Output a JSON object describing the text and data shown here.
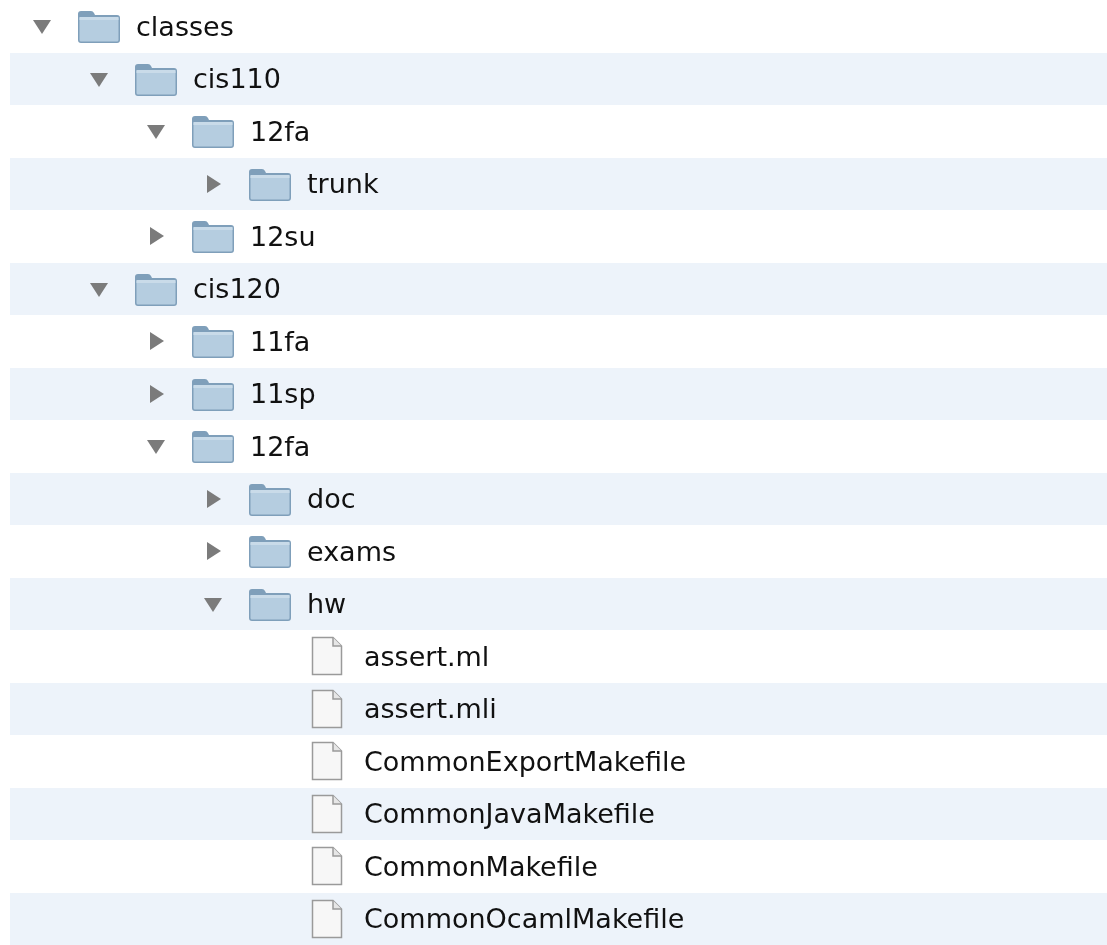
{
  "tree": [
    {
      "kind": "folder",
      "name": "classes",
      "expanded": true,
      "children": [
        {
          "kind": "folder",
          "name": "cis110",
          "expanded": true,
          "children": [
            {
              "kind": "folder",
              "name": "12fa",
              "expanded": true,
              "children": [
                {
                  "kind": "folder",
                  "name": "trunk",
                  "expanded": false
                }
              ]
            },
            {
              "kind": "folder",
              "name": "12su",
              "expanded": false
            }
          ]
        },
        {
          "kind": "folder",
          "name": "cis120",
          "expanded": true,
          "children": [
            {
              "kind": "folder",
              "name": "11fa",
              "expanded": false
            },
            {
              "kind": "folder",
              "name": "11sp",
              "expanded": false
            },
            {
              "kind": "folder",
              "name": "12fa",
              "expanded": true,
              "children": [
                {
                  "kind": "folder",
                  "name": "doc",
                  "expanded": false
                },
                {
                  "kind": "folder",
                  "name": "exams",
                  "expanded": false
                },
                {
                  "kind": "folder",
                  "name": "hw",
                  "expanded": true,
                  "children": [
                    {
                      "kind": "file",
                      "name": "assert.ml"
                    },
                    {
                      "kind": "file",
                      "name": "assert.mli"
                    },
                    {
                      "kind": "file",
                      "name": "CommonExportMakefile"
                    },
                    {
                      "kind": "file",
                      "name": "CommonJavaMakefile"
                    },
                    {
                      "kind": "file",
                      "name": "CommonMakefile"
                    },
                    {
                      "kind": "file",
                      "name": "CommonOcamlMakefile"
                    }
                  ]
                }
              ]
            }
          ]
        }
      ]
    }
  ]
}
